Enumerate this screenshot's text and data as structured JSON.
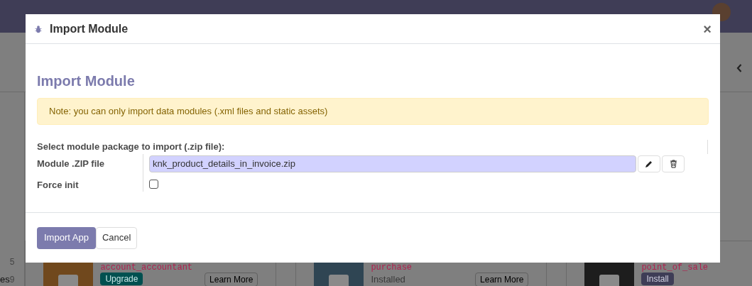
{
  "background": {
    "sidebar_counts": [
      "5",
      "9"
    ],
    "sidebar_label": "es",
    "apps": [
      {
        "technical_name": "account_accountant",
        "kind": "upgrade",
        "action": "Upgrade",
        "learn_more": "Learn More"
      },
      {
        "technical_name": "purchase",
        "kind": "installed",
        "action": "Installed",
        "learn_more": "Learn More"
      },
      {
        "technical_name": "point_of_sale",
        "kind": "install",
        "action": "Install"
      }
    ]
  },
  "dialog": {
    "title": "Import Module",
    "close": "×",
    "heading": "Import Module",
    "note": "Note: you can only import data modules (.xml files and static assets)",
    "group_label": "Select module package to import (.zip file):",
    "fields": [
      {
        "kind": "file",
        "label": "Module .ZIP file",
        "value": "knk_product_details_in_invoice.zip"
      },
      {
        "kind": "checkbox",
        "label": "Force init",
        "checked": false
      }
    ],
    "buttons": [
      {
        "kind": "primary",
        "label": "Import App"
      },
      {
        "kind": "secondary",
        "label": "Cancel"
      }
    ]
  }
}
